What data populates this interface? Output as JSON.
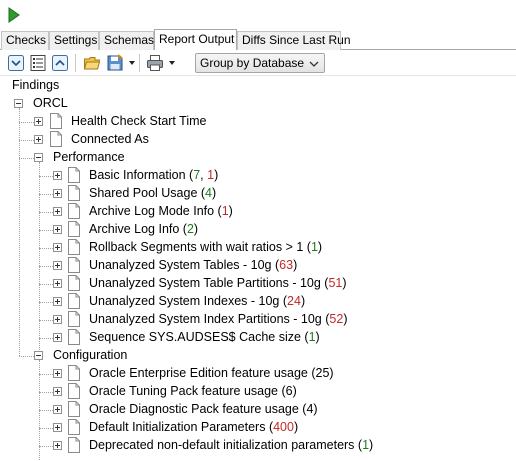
{
  "toolbar_top": {
    "run_tooltip": ""
  },
  "tabs": [
    {
      "label": "Checks",
      "active": false
    },
    {
      "label": "Settings",
      "active": false
    },
    {
      "label": "Schemas",
      "active": false
    },
    {
      "label": "Report Output",
      "active": true
    },
    {
      "label": "Diffs Since Last Run",
      "active": false
    }
  ],
  "toolbar": {
    "group_by": "Group by Database",
    "icons": [
      "expand-all-icon",
      "report-list-icon",
      "collapse-all-icon",
      "open-folder-icon",
      "save-icon",
      "print-icon"
    ]
  },
  "tree": {
    "root_label": "Findings",
    "database": "ORCL",
    "top_items": [
      {
        "label": "Health Check Start Time"
      },
      {
        "label": "Connected As"
      }
    ],
    "groups": [
      {
        "label": "Performance",
        "items": [
          {
            "label": "Basic Information (",
            "counts": [
              {
                "text": "7",
                "color": "green"
              },
              {
                "text": ", ",
                "color": "plain"
              },
              {
                "text": "1",
                "color": "red"
              }
            ],
            "suffix": ")"
          },
          {
            "label": "Shared Pool Usage (",
            "counts": [
              {
                "text": "4",
                "color": "green"
              }
            ],
            "suffix": ")"
          },
          {
            "label": "Archive Log Mode Info (",
            "counts": [
              {
                "text": "1",
                "color": "red"
              }
            ],
            "suffix": ")"
          },
          {
            "label": "Archive Log Info (",
            "counts": [
              {
                "text": "2",
                "color": "green"
              }
            ],
            "suffix": ")"
          },
          {
            "label": "Rollback Segments with wait ratios > 1  (",
            "counts": [
              {
                "text": "1",
                "color": "green"
              }
            ],
            "suffix": ")"
          },
          {
            "label": "Unanalyzed System Tables - 10g (",
            "counts": [
              {
                "text": "63",
                "color": "red"
              }
            ],
            "suffix": ")"
          },
          {
            "label": "Unanalyzed System Table Partitions - 10g (",
            "counts": [
              {
                "text": "51",
                "color": "red"
              }
            ],
            "suffix": ")"
          },
          {
            "label": "Unanalyzed System Indexes - 10g (",
            "counts": [
              {
                "text": "24",
                "color": "red"
              }
            ],
            "suffix": ")"
          },
          {
            "label": "Unanalyzed System Index Partitions - 10g (",
            "counts": [
              {
                "text": "52",
                "color": "red"
              }
            ],
            "suffix": ")"
          },
          {
            "label": "Sequence SYS.AUDSES$ Cache size (",
            "counts": [
              {
                "text": "1",
                "color": "green"
              }
            ],
            "suffix": ")"
          }
        ]
      },
      {
        "label": "Configuration",
        "items": [
          {
            "label": "Oracle Enterprise Edition feature usage (",
            "counts": [
              {
                "text": "25",
                "color": "plain"
              }
            ],
            "suffix": ")"
          },
          {
            "label": "Oracle Tuning Pack feature usage (",
            "counts": [
              {
                "text": "6",
                "color": "plain"
              }
            ],
            "suffix": ")"
          },
          {
            "label": "Oracle Diagnostic Pack feature usage (",
            "counts": [
              {
                "text": "4",
                "color": "plain"
              }
            ],
            "suffix": ")"
          },
          {
            "label": "Default Initialization Parameters (",
            "counts": [
              {
                "text": "400",
                "color": "red"
              }
            ],
            "suffix": ")"
          },
          {
            "label": "Deprecated non-default initialization parameters (",
            "counts": [
              {
                "text": "1",
                "color": "green"
              }
            ],
            "suffix": ")"
          }
        ]
      }
    ]
  },
  "colors": {
    "green": "#1e7b1e",
    "red": "#c62828",
    "run": "#2e9b2e"
  }
}
